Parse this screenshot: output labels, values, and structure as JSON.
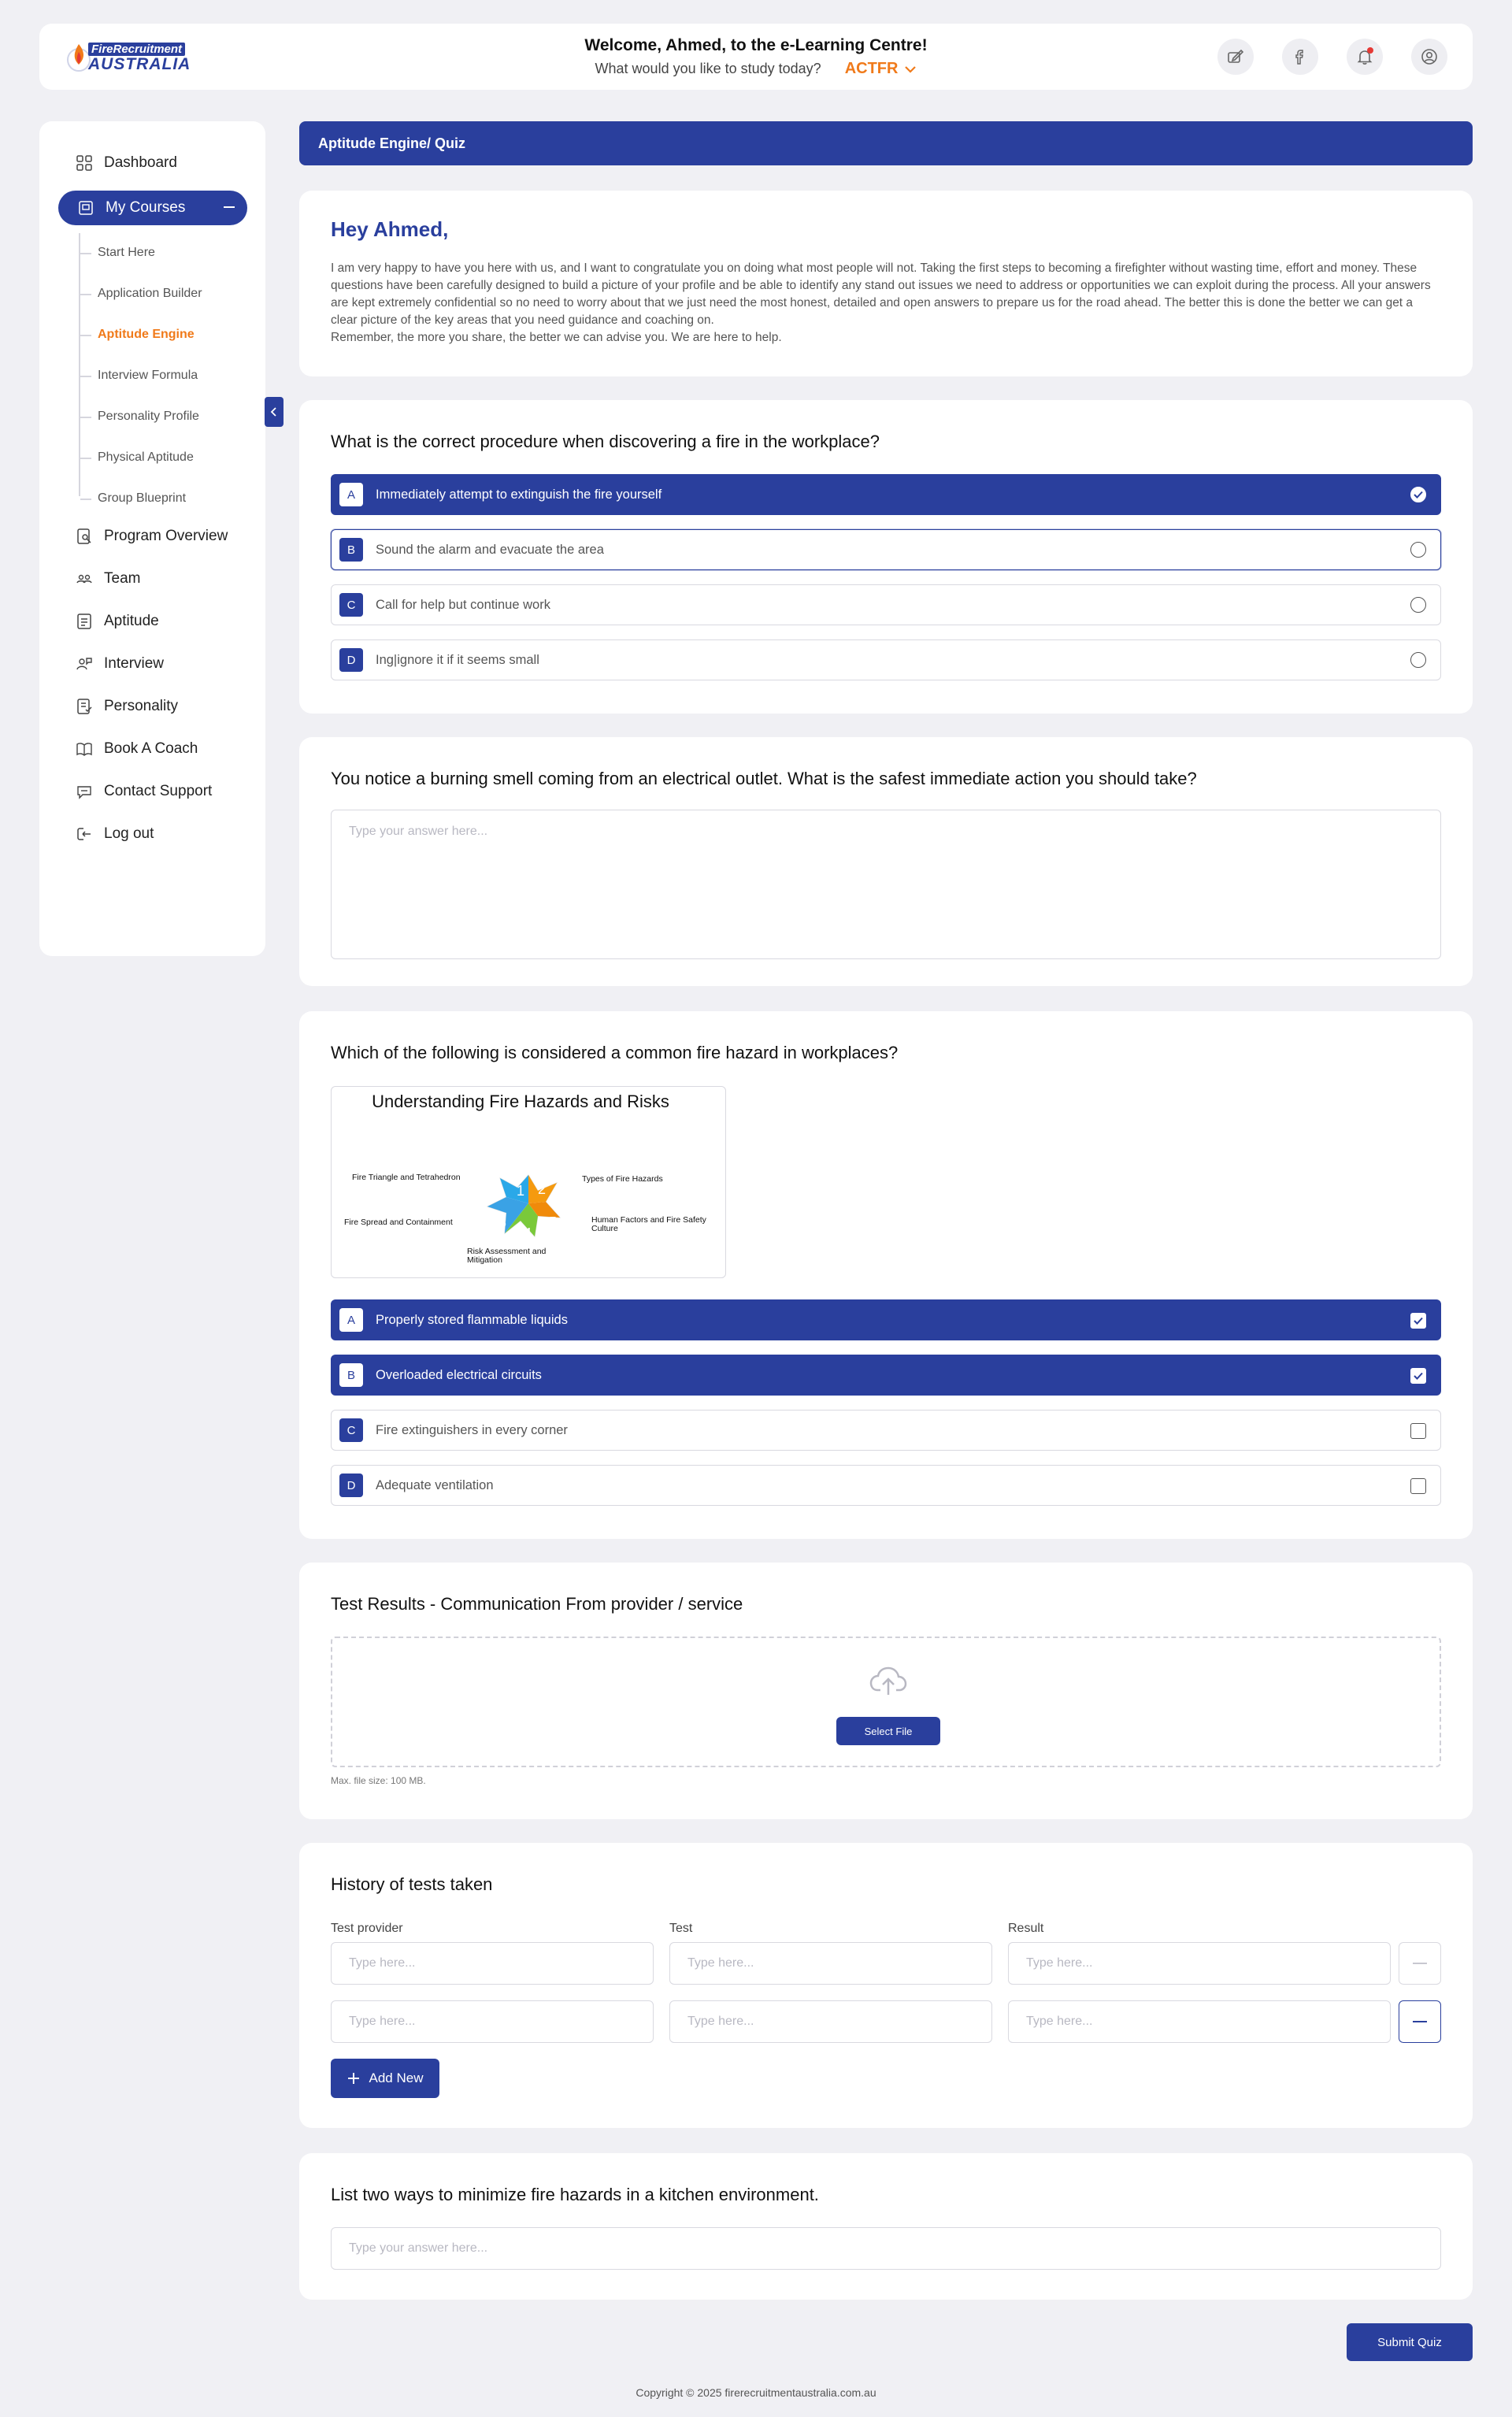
{
  "logo": {
    "top": "FireRecruitment",
    "bottom": "AUSTRALIA"
  },
  "header": {
    "welcome": "Welcome, Ahmed, to the e-Learning Centre!",
    "prompt": "What would you like to study today?",
    "course": "ACTFR",
    "icons": [
      "write-icon",
      "facebook-icon",
      "bell-icon",
      "user-icon"
    ],
    "accent": "#2a3f9d",
    "orange": "#f07a1a"
  },
  "sidebar": {
    "dashboard": "Dashboard",
    "my_courses": "My Courses",
    "sub": [
      "Start Here",
      "Application Builder",
      "Aptitude Engine",
      "Interview Formula",
      "Personality Profile",
      "Physical Aptitude",
      "Group Blueprint"
    ],
    "items": [
      "Program Overview",
      "Team",
      "Aptitude",
      "Interview",
      "Personality",
      "Book A Coach",
      "Contact Support",
      "Log out"
    ]
  },
  "banner": "Aptitude Engine/ Quiz",
  "intro": {
    "title": "Hey Ahmed,",
    "text": "I am very happy to have you here with us, and I want to congratulate you on doing what most people will not. Taking the first steps to becoming a firefighter without wasting time, effort and money. These questions have been carefully designed to build a picture of your profile and be able to identify any stand out issues we need to address or opportunities we can exploit during the process. All your answers are kept extremely confidential so no need to worry about that we just need the most honest, detailed and open answers to prepare us for the road ahead. The better  this is done the better we can get a clear picture of the key areas that you need guidance and coaching  on.",
    "text2": "Remember, the more you share, the better we can advise you. We are here to help."
  },
  "q1": {
    "title": "What is the correct procedure when discovering a fire in the workplace?",
    "options": [
      {
        "letter": "A",
        "text": "Immediately attempt to extinguish the fire yourself"
      },
      {
        "letter": "B",
        "text": "Sound the alarm and evacuate the area"
      },
      {
        "letter": "C",
        "text": "Call for help but continue work"
      },
      {
        "letter": "D",
        "text": "Ing|ignore it if it seems small"
      }
    ]
  },
  "q2": {
    "title": "You notice a burning smell coming from an electrical outlet. What is the safest immediate action you should take?",
    "placeholder": "Type your answer here..."
  },
  "q3": {
    "title": "Which of the following is considered a common fire hazard in workplaces?",
    "figure": {
      "title": "Understanding Fire Hazards and Risks",
      "labels": [
        "Fire Triangle and Tetrahedron",
        "Types of Fire Hazards",
        "Fire Spread and Containment",
        "Human Factors and Fire Safety Culture",
        "Risk Assessment and Mitigation"
      ],
      "numbers": [
        "1",
        "2",
        "3",
        "4",
        "5"
      ]
    },
    "options": [
      {
        "letter": "A",
        "text": "Properly stored flammable liquids"
      },
      {
        "letter": "B",
        "text": "Overloaded electrical circuits"
      },
      {
        "letter": "C",
        "text": "Fire extinguishers in every corner"
      },
      {
        "letter": "D",
        "text": "Adequate ventilation"
      }
    ]
  },
  "upload": {
    "title": "Test Results - Communication From provider / service",
    "button": "Select File",
    "note": "Max. file size: 100 MB."
  },
  "history": {
    "title": "History of tests taken",
    "cols": [
      "Test provider",
      "Test",
      "Result"
    ],
    "placeholder": "Type here...",
    "add": "Add New"
  },
  "q5": {
    "title": "List two ways to minimize fire hazards in a kitchen environment.",
    "placeholder": "Type your answer here..."
  },
  "submit": "Submit Quiz",
  "footer": "Copyright © 2025 firerecruitmentaustralia.com.au"
}
